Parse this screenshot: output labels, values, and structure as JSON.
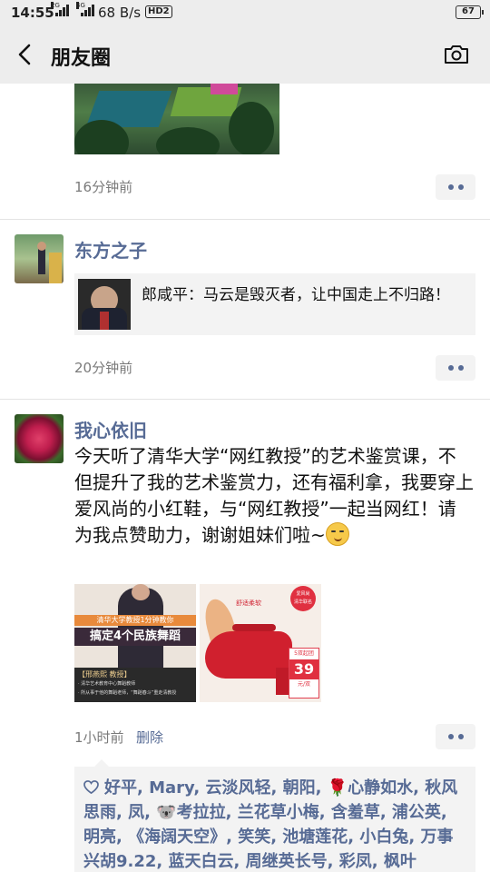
{
  "status": {
    "time": "14:55",
    "net1": "2G",
    "net2": "4G",
    "speed": "68 B/s",
    "hd": "HD2",
    "battery": "67"
  },
  "nav": {
    "title": "朋友圈",
    "back_icon": "chevron-left-icon",
    "camera_icon": "camera-icon"
  },
  "posts": [
    {
      "time": "16分钟前"
    },
    {
      "author": "东方之子",
      "link_title": "郎咸平：马云是毁灭者，让中国走上不归路！",
      "time": "20分钟前"
    },
    {
      "author": "我心依旧",
      "text": "今天听了清华大学“网红教授”的艺术鉴赏课，不但提升了我的艺术鉴赏力，还有福利拿，我要穿上爱风尚的小红鞋，与“网红教授”一起当网红！请为我点赞助力，谢谢姐妹们啦~",
      "images": [
        {
          "title": "清华大学教授1分钟教你",
          "headline": "搞定4个民族舞蹈",
          "caption": "【邢燕熙 教授】",
          "note1": "· 清华艺术教育中心舞蹈教师",
          "note2": "· 所从事于他的舞蹈老师，“舞蹈春斗”重走清教授"
        },
        {
          "badge": "舒适柔软",
          "corner_tag1": "爱风尚",
          "corner_tag2": "清华联名",
          "price_label": "5双起团",
          "price": "39",
          "unit": "元/双"
        }
      ],
      "time": "1小时前",
      "delete_label": "删除",
      "likes": "好平, Mary, 云淡风轻, 朝阳, 🌹心静如水, 秋风思雨, 凤, 🐨考拉拉, 兰花草小梅, 含羞草, 浦公英, 明亮, 《海阔天空》, 笑笑, 池塘莲花, 小白兔, 万事兴胡9.22, 蓝天白云, 周继英长号, 彩凤, 枫叶"
    }
  ],
  "colors": {
    "link_blue": "#576b95",
    "header_bg": "#ededed",
    "card_bg": "#f3f3f3"
  }
}
